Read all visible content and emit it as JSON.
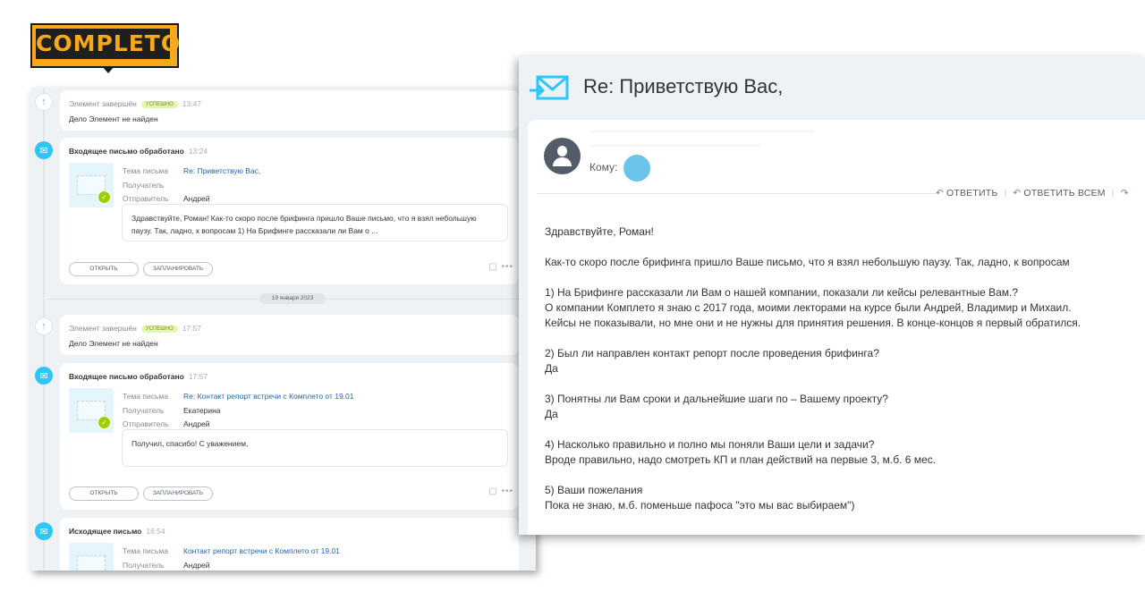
{
  "logo": {
    "text": "COMPLETO"
  },
  "crm": {
    "date_separator": "19 января 2023",
    "cards": [
      {
        "title": "Элемент завершён",
        "badge": "УСПЕШНО",
        "time": "13:47",
        "line_label": "Дело",
        "line_value": "Элемент не найден"
      },
      {
        "title": "Входящее письмо обработано",
        "time": "13:24",
        "subject_label": "Тема письма",
        "subject": "Re: Приветствую Вас,",
        "recipient_label": "Получатель",
        "recipient": "",
        "sender_label": "Отправитель",
        "sender": "Андрей",
        "preview": "Здравствуйте, Роман! Как-то скоро после брифинга пришло Ваше письмо, что я взял небольшую паузу. Так, ладно, к вопросам 1) На Брифинге рассказали ли Вам о ...",
        "open_label": "ОТКРЫТЬ",
        "plan_label": "ЗАПЛАНИРОВАТЬ"
      },
      {
        "title": "Элемент завершён",
        "badge": "УСПЕШНО",
        "time": "17:57",
        "line_label": "Дело",
        "line_value": "Элемент не найден"
      },
      {
        "title": "Входящее письмо обработано",
        "time": "17:57",
        "subject_label": "Тема письма",
        "subject": "Re: Контакт репорт встречи с Комплето от 19.01",
        "recipient_label": "Получатель",
        "recipient": "Екатерина",
        "sender_label": "Отправитель",
        "sender": "Андрей",
        "preview": "Получил, спасибо! С уважением,",
        "open_label": "ОТКРЫТЬ",
        "plan_label": "ЗАПЛАНИРОВАТЬ"
      },
      {
        "title": "Исходящее письмо",
        "time": "16:54",
        "subject_label": "Тема письма",
        "subject": "Контакт репорт встречи с Комплето от 19.01",
        "recipient_label": "Получатель",
        "recipient": "Андрей"
      }
    ]
  },
  "mail": {
    "title": "Re: Приветствую Вас,",
    "to_label": "Кому:",
    "reply_label": "ОТВЕТИТЬ",
    "reply_all_label": "ОТВЕТИТЬ ВСЕМ",
    "body": [
      "Здравствуйте, Роман!",
      "",
      "Как-то скоро после брифинга пришло Ваше письмо, что я взял небольшую паузу. Так, ладно, к вопросам",
      "",
      "1) На Брифинге рассказали ли Вам о нашей компании, показали ли кейсы релевантные Вам.?",
      "О компании Комплето я знаю с 2017 года, моими лекторами на курсе были Андрей, Владимир и Михаил.",
      "Кейсы не показывали, но мне они и не нужны для принятия решения. В конце-концов я первый обратился.",
      "",
      "2) Был ли направлен контакт репорт после проведения брифинга?",
      "Да",
      "",
      "3) Понятны ли Вам сроки и дальнейшие шаги по – Вашему проекту?",
      "Да",
      "",
      "4) Насколько правильно и полно мы поняли Ваши цели и задачи?",
      "Вроде правильно, надо смотреть КП и план действий на первые 3, м.б. 6 мес.",
      "",
      "5) Ваши пожелания",
      "Пока не знаю, м.б. поменьше пафоса \"это мы вас выбираем\")"
    ]
  },
  "colors": {
    "accent": "#2fc6f6",
    "logo_bg": "#f7a81b",
    "link": "#2067b0",
    "badge_bg": "#e3f5b3"
  }
}
